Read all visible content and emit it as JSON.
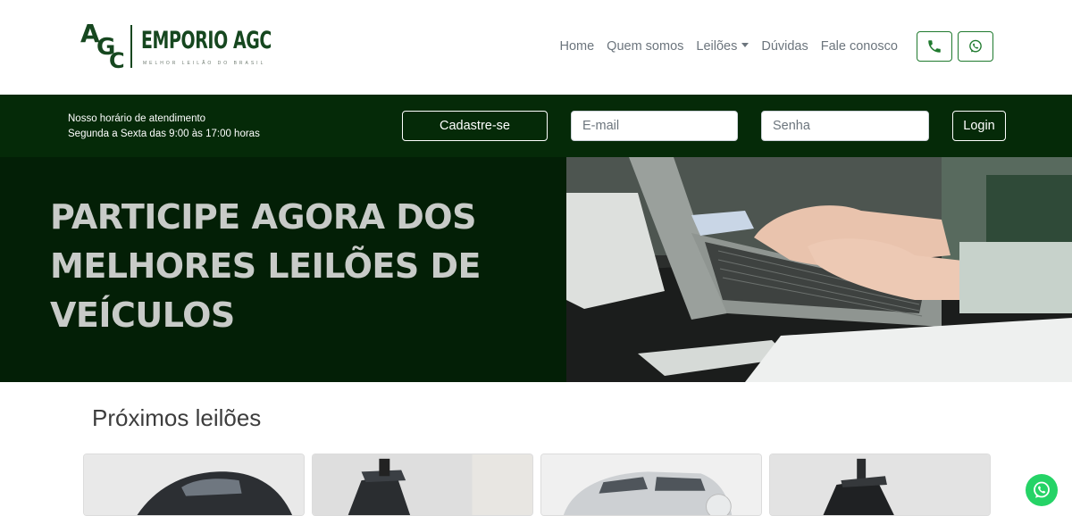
{
  "brand": {
    "mark_a": "A",
    "mark_g": "G",
    "mark_c": "C",
    "name": "EMPORIO AGC",
    "tagline": "MELHOR LEILÃO DO BRASIL",
    "color": "#16471f"
  },
  "nav": {
    "items": [
      {
        "label": "Home"
      },
      {
        "label": "Quem somos"
      },
      {
        "label": "Leilões"
      },
      {
        "label": "Dúvidas"
      },
      {
        "label": "Fale conosco"
      }
    ],
    "phone_icon": "phone-icon",
    "whatsapp_icon": "whatsapp-icon"
  },
  "topbar": {
    "hours_line1": "Nosso horário de atendimento",
    "hours_line2": "Segunda a Sexta das 9:00 às 17:00 horas",
    "register_label": "Cadastre-se",
    "email_placeholder": "E-mail",
    "password_placeholder": "Senha",
    "login_label": "Login",
    "bg_color": "#052a08"
  },
  "hero": {
    "title": "PARTICIPE AGORA DOS MELHORES LEILÕES DE VEÍCULOS",
    "image": "person typing on laptop"
  },
  "auctions": {
    "title": "Próximos leilões",
    "cards": [
      {
        "image": "black hatchback car"
      },
      {
        "image": "adventure motorcycle"
      },
      {
        "image": "silver SUV"
      },
      {
        "image": "black motorcycle"
      }
    ]
  },
  "floating": {
    "whatsapp_icon": "whatsapp-icon",
    "color": "#25d366"
  }
}
